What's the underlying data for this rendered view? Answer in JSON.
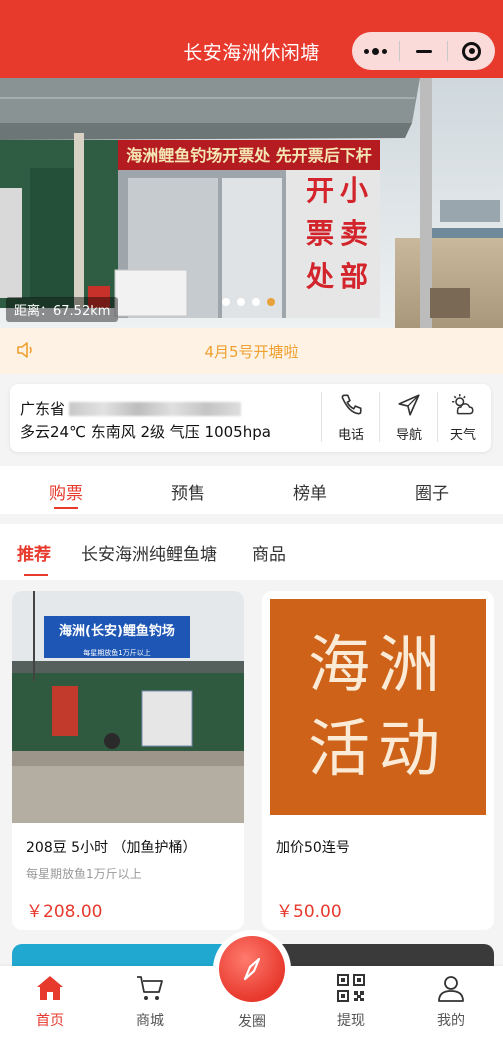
{
  "header": {
    "title": "长安海洲休闲塘"
  },
  "banner": {
    "sign_text": "海洲鲤鱼钓场开票处 先开票后下杆",
    "left_sign_chars": [
      "开",
      "票",
      "处"
    ],
    "right_sign_chars": [
      "小",
      "卖",
      "部"
    ],
    "distance": "距离：67.52km",
    "indicators": 4,
    "active_indicator": 3
  },
  "notice": {
    "text": "4月5号开塘啦"
  },
  "info": {
    "address_visible": "广东省",
    "weather": "多云24℃ 东南风 2级 气压 1005hpa",
    "actions": [
      {
        "label": "电话",
        "icon": "phone-icon"
      },
      {
        "label": "导航",
        "icon": "navigate-icon"
      },
      {
        "label": "天气",
        "icon": "weather-icon"
      }
    ]
  },
  "tabs": [
    "购票",
    "预售",
    "榜单",
    "圈子"
  ],
  "active_tab": 0,
  "subtabs": [
    "推荐",
    "长安海洲纯鲤鱼塘",
    "商品"
  ],
  "active_subtab": 0,
  "products": [
    {
      "name": "208豆 5小时 （加鱼护桶）",
      "desc": "每星期放鱼1万斤以上",
      "price": "￥208.00",
      "image_sign": "海洲(长安)鲤鱼钓场",
      "image_subsign": "每星期放鱼1万斤以上"
    },
    {
      "name": "加价50连号",
      "desc": "",
      "price": "￥50.00",
      "image_text_line1": "海洲",
      "image_text_line2": "活动"
    }
  ],
  "nav": {
    "items": [
      {
        "label": "首页",
        "icon": "home-icon"
      },
      {
        "label": "商城",
        "icon": "cart-icon"
      },
      {
        "label": "发圈",
        "icon": "compass-icon"
      },
      {
        "label": "提现",
        "icon": "qrcode-icon"
      },
      {
        "label": "我的",
        "icon": "user-icon"
      }
    ],
    "active": 0
  },
  "colors": {
    "primary": "#e8392d",
    "notice": "#f0a030",
    "notice_bg": "#fdf2e4"
  }
}
